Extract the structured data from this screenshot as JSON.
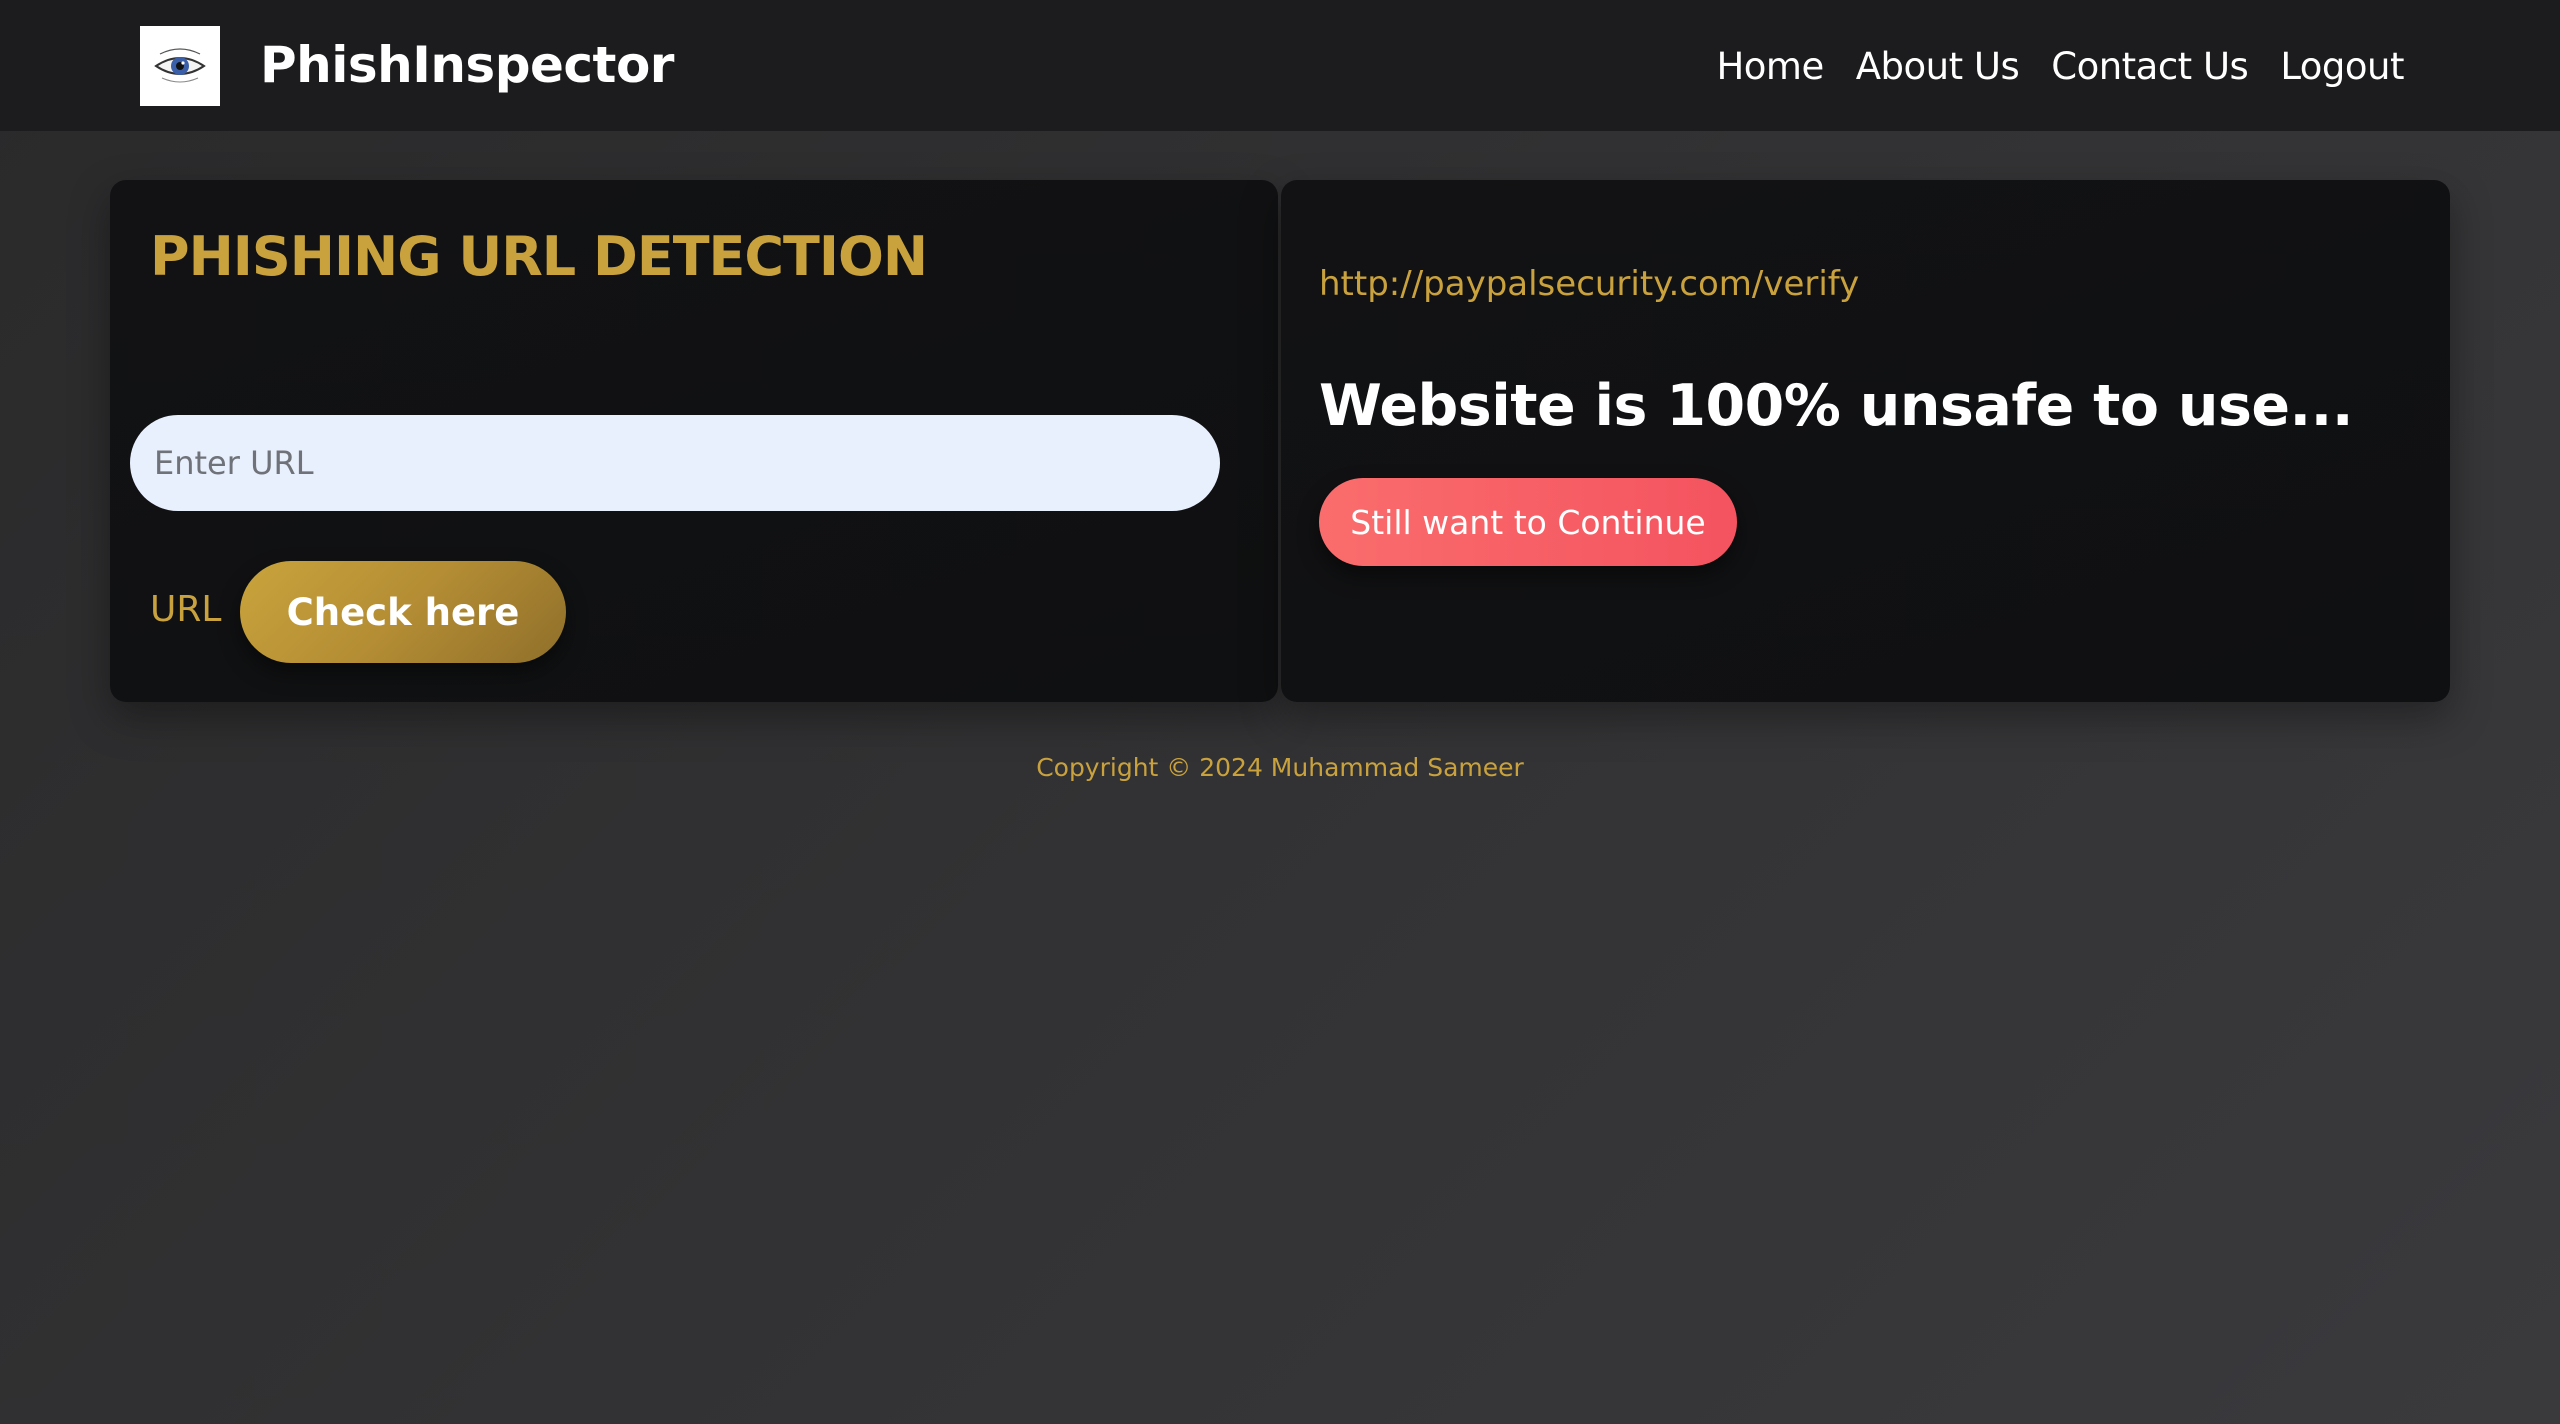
{
  "navbar": {
    "brand": "PhishInspector",
    "logo_icon": "eye-logo-icon",
    "links": [
      "Home",
      "About Us",
      "Contact Us",
      "Logout"
    ]
  },
  "detection": {
    "title": "PHISHING URL DETECTION",
    "input_placeholder": "Enter URL",
    "input_value": "",
    "url_label": "URL",
    "check_button": "Check here"
  },
  "result": {
    "checked_url": "http://paypalsecurity.com/verify",
    "verdict": "Website is 100% unsafe to use...",
    "continue_button": "Still want to Continue"
  },
  "footer": {
    "copyright": "Copyright © 2024 Muhammad Sameer"
  },
  "colors": {
    "accent_gold": "#c9a23e",
    "danger_red": "#f4535f",
    "navbar_bg": "#1c1c1e",
    "card_bg": "#121214",
    "input_bg": "#e8effd"
  }
}
